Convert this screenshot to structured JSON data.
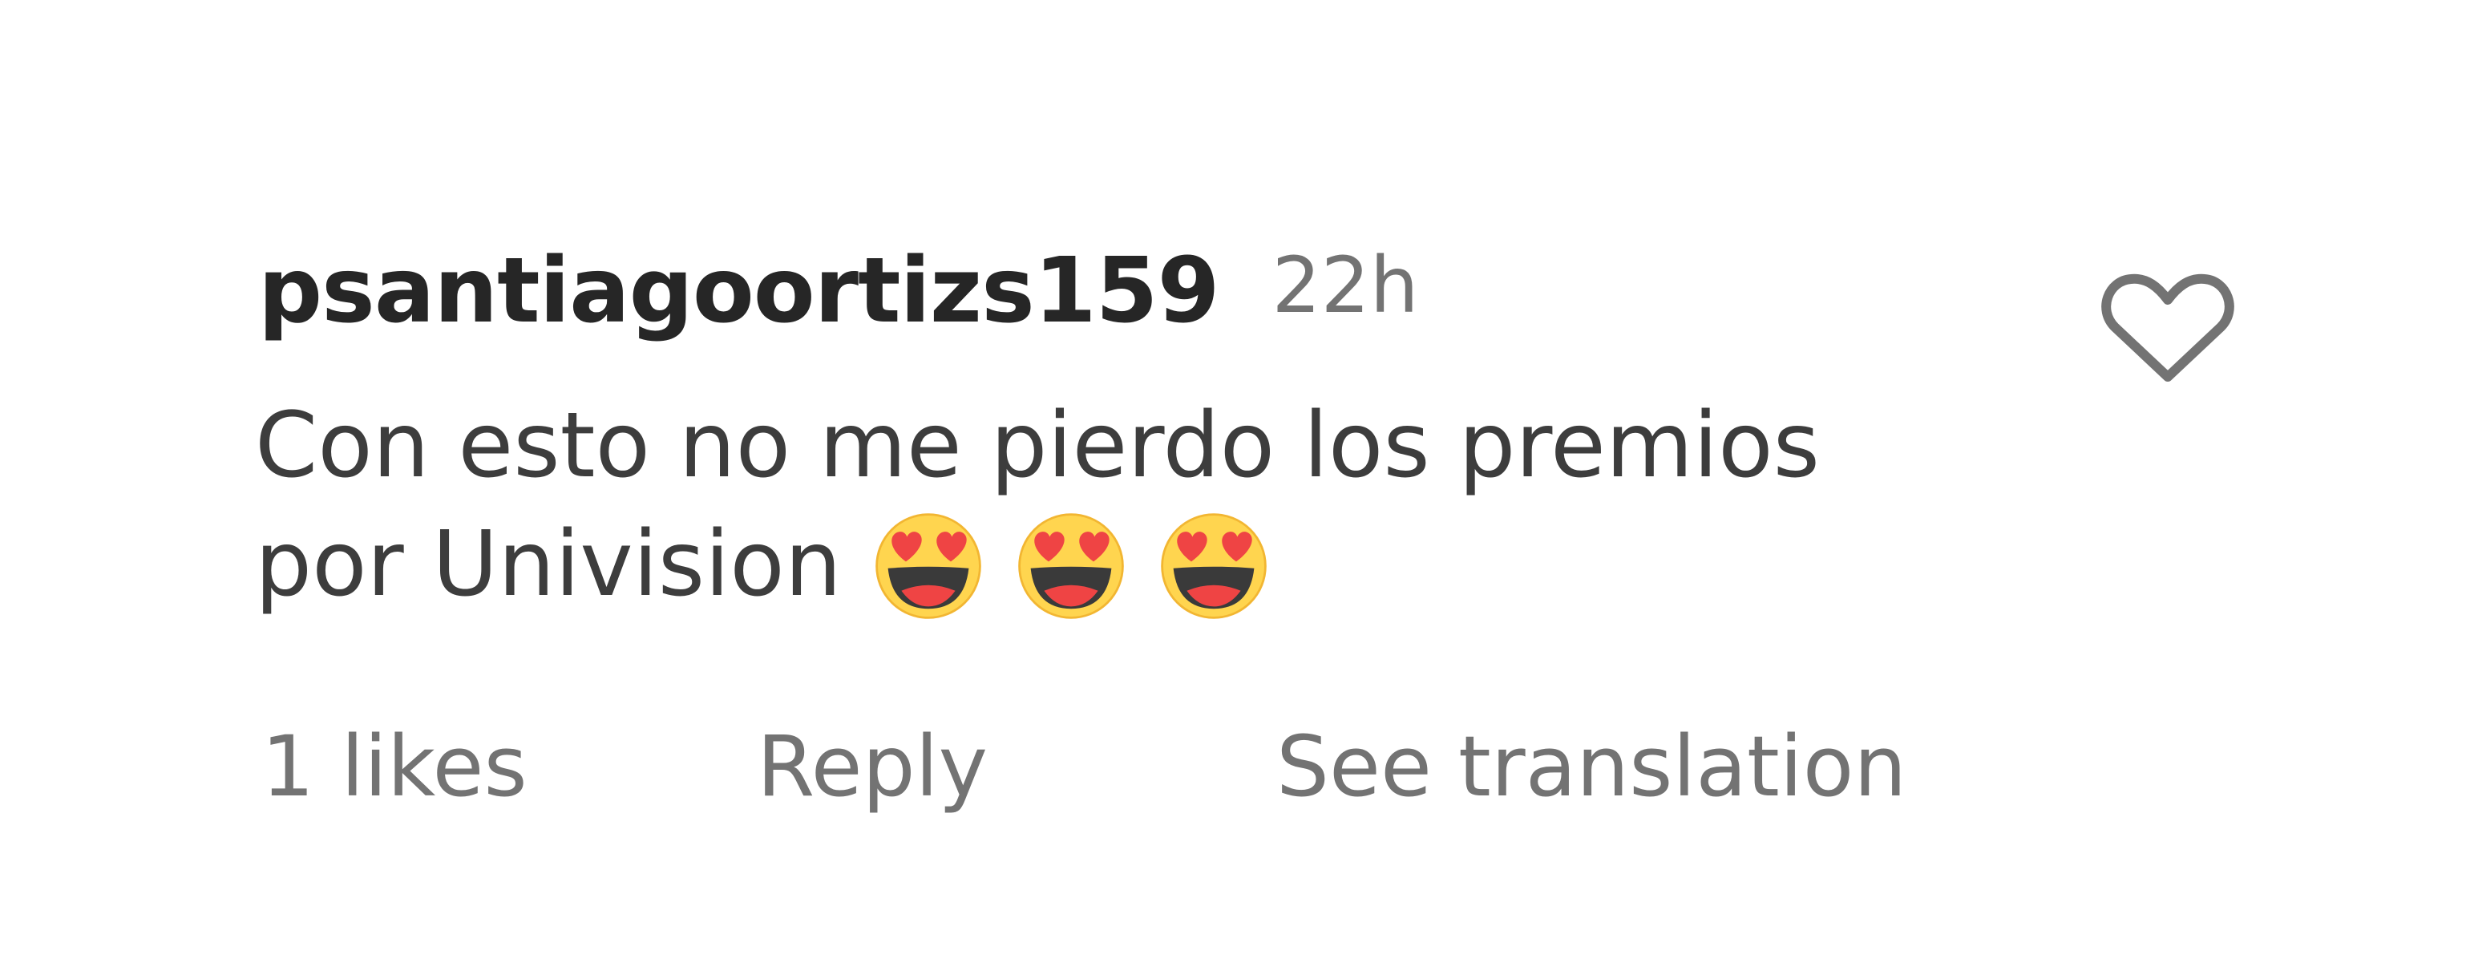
{
  "comment": {
    "username": "psantiagoortizs159",
    "timestamp": "22h",
    "text_line1": "Con esto no me pierdo los premios",
    "text_line2": "por Univision",
    "emojis": [
      "smiling-face-with-heart-eyes",
      "smiling-face-with-heart-eyes",
      "smiling-face-with-heart-eyes"
    ]
  },
  "actions": {
    "likes": "1 likes",
    "reply": "Reply",
    "see_translation": "See translation"
  },
  "icons": {
    "like": "heart-outline-icon"
  },
  "colors": {
    "username": "#262626",
    "body_text": "#3d3d3d",
    "secondary_text": "#737373",
    "heart_outline": "#737373",
    "emoji_face": "#FFD54F",
    "emoji_heart": "#EF4444"
  }
}
